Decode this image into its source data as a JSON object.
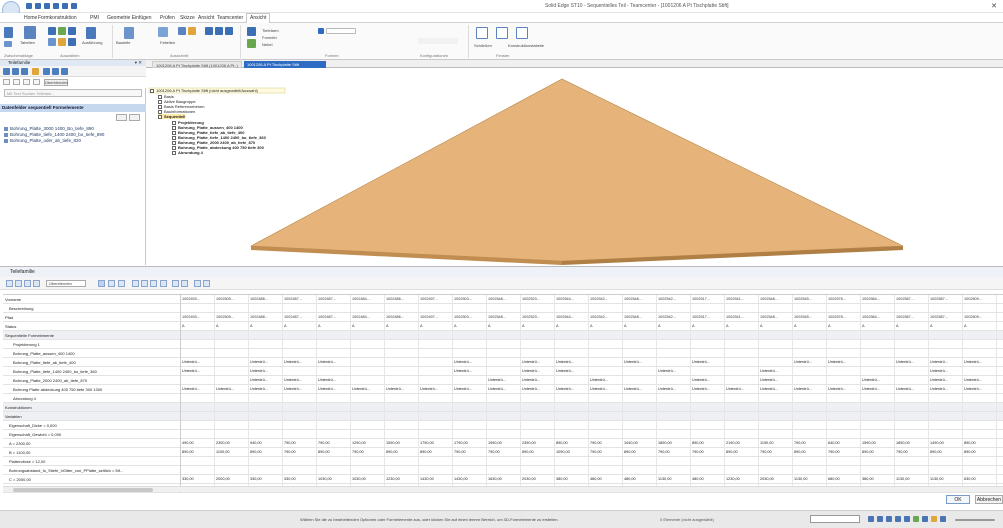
{
  "window": {
    "title": "Solid Edge ST10 - Sequentielles Teil - Teamcenter - [1001206 A Pt Tischplatte Stift]"
  },
  "tabs": [
    "Home",
    "Formkonstruktion",
    "PMI",
    "Geometrie Einfügen",
    "Prüfen",
    "Skizze",
    "Ansicht",
    "Teamcenter",
    "Ansicht"
  ],
  "ribbon": {
    "groups": [
      "Zwischenablage",
      "Auswählen",
      "Ausschnitt",
      "Formen",
      "Konfigurationen",
      "Fenster"
    ],
    "labels": [
      "Tabellen",
      "Ausführung",
      "Bauteile",
      "Feiteilen",
      "Tiefelarm",
      "Formeln",
      "Nebel",
      "Schließen",
      "Konstruktionstabelle"
    ]
  },
  "left_pane": {
    "title": "Teilefamilie",
    "filter_button": "Überblenden",
    "search_placeholder": "Mit Text Suchen Teilefam...",
    "section": "Datenfelder sequentiell Formelemente",
    "items": [
      "Bohrung_Platte_3000 1400_Bo_tiefe_890",
      "Bohrung_Platte_tiefe_1400 2400_bo_tiefe_890",
      "Bohrung_Platte_oder_ab_tiefe_820"
    ]
  },
  "doc_tabs": [
    "1001206 A Pt Tischplatte Stift (1001206 A Pt..)",
    "1001206 A Pt Tischplatte Stift"
  ],
  "tree": {
    "root": "1001206 A Pt Tischplatte Stift (nicht ausgewählt/Auswahl)",
    "nodes": [
      "Basis",
      "Aktive Baugruppe",
      "Basis Referenzebenen",
      "Bauinformationen",
      "Sequentiell",
      "Projektierung",
      "Bohrung_Platte_aussen_400 1400",
      "Bohrung_Platte_tiefe_ab_tiefe_400",
      "Bohrung_Platte_tiefe_1400 2400_bo_tiefe_360",
      "Bohrung_Platte_2000 2400_ab_tiefe_870",
      "Bohrung_Platte_abdeckung 400 750 tiefe 300",
      "Abrundung 4"
    ]
  },
  "bottom_panel": {
    "title": "Teilefamilie",
    "dropdown": "Überblenden",
    "rows": [
      {
        "label": "Vorname",
        "type": "hdr"
      },
      {
        "label": "Beschreibung",
        "type": "plain"
      },
      {
        "label": "Pfad",
        "type": "hdr"
      },
      {
        "label": "Status",
        "type": "hdr"
      },
      {
        "label": "Sequentielle Formelemente",
        "type": "grp"
      },
      {
        "label": "Projektierung 1",
        "type": "plain"
      },
      {
        "label": "Bohrung_Platte_aussen_400 1400",
        "type": "plain"
      },
      {
        "label": "Bohrung_Platte_tiefe_ab_tiefe_400",
        "type": "plain"
      },
      {
        "label": "Bohrung_Platte_tiefe_1400 2400_bo_tiefe_360",
        "type": "plain"
      },
      {
        "label": "Bohrung_Platte_2000 2400_ab_tiefe_870",
        "type": "plain"
      },
      {
        "label": "Bohrung Platte abdeckung 400 750 tiefe 300 1300",
        "type": "plain"
      },
      {
        "label": "Abrundung 4",
        "type": "plain"
      },
      {
        "label": "Konstruktionen",
        "type": "grp"
      },
      {
        "label": "Variablen",
        "type": "grp"
      },
      {
        "label": "Eigenschaft_Dicke = 0,000",
        "type": "plain"
      },
      {
        "label": "Eigenschaft_Gewicht = 0,000",
        "type": "plain"
      },
      {
        "label": "A = 2300,00",
        "type": "plain"
      },
      {
        "label": "B = 1100,00",
        "type": "plain"
      },
      {
        "label": "Plattendicke = 12,00",
        "type": "plain"
      },
      {
        "label": "Bohrungsabstand_fu_Stiefe_hGitter_von_PPlatte_seitlich = 5tf...",
        "type": "plain"
      },
      {
        "label": "C = 2000,00",
        "type": "plain"
      },
      {
        "label": "D = 1400,00",
        "type": "plain"
      }
    ],
    "columns": [
      "1002493...",
      "1002505...",
      "1002488...",
      "1002487...",
      "1002487...",
      "1002484...",
      "1002486...",
      "1002497...",
      "1002503...",
      "1002548...",
      "1002523...",
      "1002544...",
      "1002542...",
      "1002548...",
      "1002542...",
      "1002517...",
      "1002541...",
      "1002548...",
      "1002545...",
      "1002578...",
      "1002584...",
      "1002587...",
      "1002587...",
      "1002609..."
    ],
    "rows_values": {
      "0": [
        "1002493...",
        "1002505...",
        "1002488...",
        "1002487...",
        "1002487...",
        "1002484...",
        "1002486...",
        "1002497...",
        "1002503...",
        "1002548...",
        "1002523...",
        "1002544...",
        "1002542...",
        "1002548...",
        "1002542...",
        "1002517...",
        "1002541...",
        "1002548...",
        "1002545...",
        "1002578...",
        "1002584...",
        "1002587...",
        "1002587...",
        "1002609..."
      ],
      "2": [
        "1002493...",
        "1002505...",
        "1002488...",
        "1002487...",
        "1002487...",
        "1002484...",
        "1002486...",
        "1002497...",
        "1002503...",
        "1002548...",
        "1002523...",
        "1002544...",
        "1002542...",
        "1002548...",
        "1002542...",
        "1002517...",
        "1002541...",
        "1002548...",
        "1002545...",
        "1002578...",
        "1002584...",
        "1002587...",
        "1002587...",
        "1002609..."
      ],
      "3": [
        "A",
        "A",
        "A",
        "A",
        "A",
        "A",
        "A",
        "A",
        "A",
        "A",
        "A",
        "A",
        "A",
        "A",
        "A",
        "A",
        "A",
        "A",
        "A",
        "A",
        "A",
        "A",
        "A",
        "A"
      ],
      "7": [
        "Unterdrü...",
        "",
        "Unterdrü...",
        "Unterdrü...",
        "Unterdrü...",
        "",
        "",
        "",
        "Unterdrü...",
        "",
        "Unterdrü...",
        "Unterdrü...",
        "",
        "Unterdrü...",
        "",
        "Unterdrü...",
        "",
        "",
        "Unterdrü...",
        "Unterdrü...",
        "",
        "Unterdrü...",
        "Unterdrü...",
        "Unterdrü..."
      ],
      "8": [
        "Unterdrü...",
        "",
        "Unterdrü...",
        "",
        "",
        "",
        "",
        "",
        "Unterdrü...",
        "",
        "Unterdrü...",
        "Unterdrü...",
        "",
        "",
        "Unterdrü...",
        "",
        "",
        "Unterdrü...",
        "",
        "",
        "",
        "",
        "Unterdrü...",
        ""
      ],
      "9": [
        "",
        "",
        "Unterdrü...",
        "Unterdrü...",
        "Unterdrü...",
        "",
        "",
        "",
        "",
        "Unterdrü...",
        "Unterdrü...",
        "",
        "Unterdrü...",
        "",
        "",
        "Unterdrü...",
        "",
        "Unterdrü...",
        "",
        "",
        "Unterdrü...",
        "",
        "Unterdrü...",
        "Unterdrü..."
      ],
      "10": [
        "Unterdrü...",
        "Unterdrü...",
        "Unterdrü...",
        "Unterdrü...",
        "Unterdrü...",
        "Unterdrü...",
        "Unterdrü...",
        "Unterdrü...",
        "Unterdrü...",
        "Unterdrü...",
        "Unterdrü...",
        "Unterdrü...",
        "Unterdrü...",
        "Unterdrü...",
        "Unterdrü...",
        "Unterdrü...",
        "Unterdrü...",
        "Unterdrü...",
        "Unterdrü...",
        "Unterdrü...",
        "Unterdrü...",
        "Unterdrü...",
        "Unterdrü...",
        "Unterdrü..."
      ],
      "16": [
        "490,00",
        "2300,00",
        "940,00",
        "790,00",
        "790,00",
        "1290,00",
        "1590,00",
        "1790,00",
        "1790,00",
        "1990,00",
        "2390,00",
        "890,00",
        "790,00",
        "1040,00",
        "1890,00",
        "890,00",
        "2190,00",
        "1190,00",
        "790,00",
        "640,00",
        "1590,00",
        "1890,00",
        "1490,00",
        "890,00"
      ],
      "17": [
        "890,00",
        "1100,00",
        "890,00",
        "790,00",
        "890,00",
        "790,00",
        "890,00",
        "890,00",
        "790,00",
        "790,00",
        "890,00",
        "1090,00",
        "790,00",
        "890,00",
        "790,00",
        "790,00",
        "890,00",
        "790,00",
        "890,00",
        "790,00",
        "890,00",
        "790,00",
        "890,00",
        "890,00"
      ],
      "20": [
        "330,00",
        "2000,00",
        "330,00",
        "330,00",
        "1030,00",
        "1030,00",
        "1230,00",
        "1430,00",
        "1430,00",
        "1630,00",
        "2030,00",
        "380,00",
        "480,00",
        "480,00",
        "1130,00",
        "480,00",
        "1230,00",
        "2030,00",
        "1130,00",
        "680,00",
        "380,00",
        "1130,00",
        "1130,00",
        "630,00"
      ],
      "21": [
        "381,30",
        "1400,00",
        "381,30",
        "331,30",
        "331,30",
        "331,30",
        "631,30",
        "631,30",
        "731,30",
        "331,30",
        "631,30",
        "381,30",
        "331,30",
        "331,30",
        "731,30",
        "631,30",
        "631,30",
        "631,30",
        "331,30",
        "331,30",
        "381,30",
        "631,30",
        "631,30",
        "331,30"
      ]
    }
  },
  "buttons": {
    "ok": "OK",
    "cancel": "Abbrechen"
  },
  "status": {
    "message": "Wählen Sie die zu bearbeitenden Optionen oder Formelemente aus, oder klicken Sie auf einen leeren Bereich, um 3D-Formelemente zu erstellen.",
    "right": "0 Elemente (nicht ausgewählt)"
  },
  "colors": {
    "plate_top": "#e8b77e",
    "plate_side": "#c79455",
    "accent": "#2d6cc2"
  }
}
